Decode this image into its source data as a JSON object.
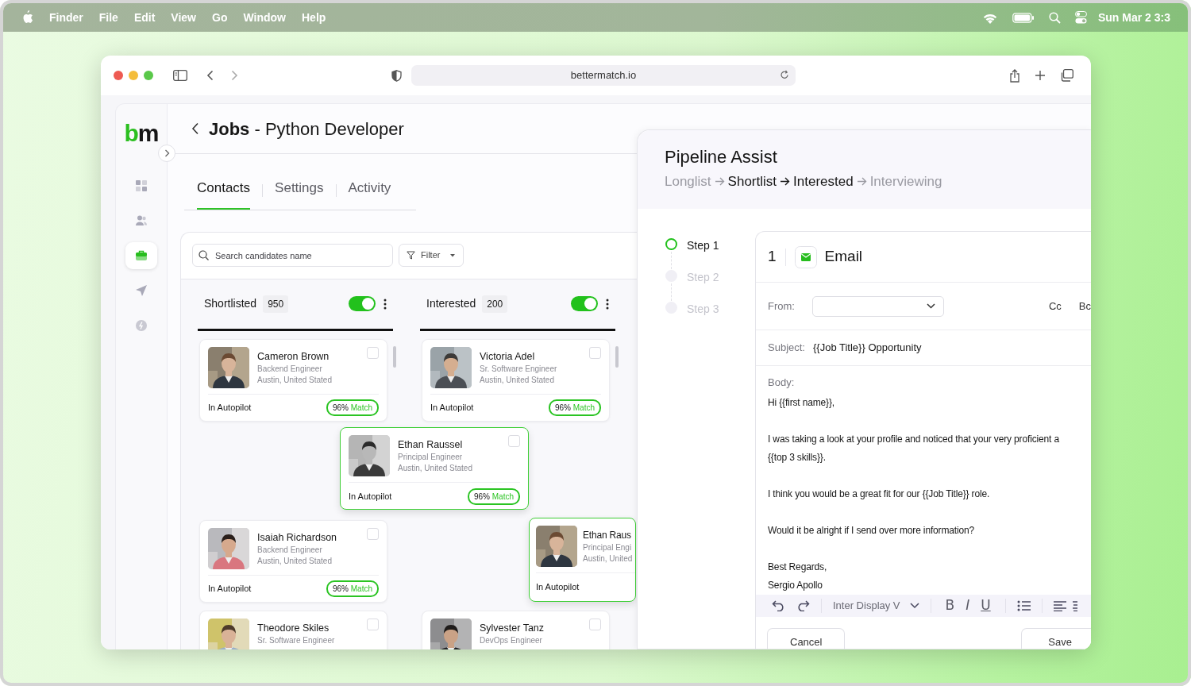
{
  "menubar": {
    "app": "Finder",
    "items": [
      "File",
      "Edit",
      "View",
      "Go",
      "Window",
      "Help"
    ],
    "clock": "Sun Mar 2 3:3"
  },
  "browser": {
    "address": "bettermatch.io"
  },
  "sidebar": {
    "logo": "bm",
    "items": [
      {
        "selected": false
      },
      {
        "selected": false
      },
      {
        "selected": true
      },
      {
        "selected": false
      },
      {
        "selected": false
      }
    ]
  },
  "page": {
    "title": "**Jobs** - Python Developer"
  },
  "tabs": [
    {
      "label": "Contacts",
      "selected": true
    },
    {
      "label": "Settings",
      "selected": false
    },
    {
      "label": "Activity",
      "selected": false
    }
  ],
  "search": {
    "placeholder": "Search candidates name"
  },
  "filter": {
    "label": "Filter"
  },
  "columns": [
    {
      "title": "Shortlisted",
      "count": "950",
      "on": true,
      "cards": [
        {
          "kind": "candidate",
          "name": "Cameron Brown",
          "role": "Backend Engineer",
          "location": "Austin, United Stated",
          "status": "In Autopilot",
          "match": "96%",
          "match_label": "Match",
          "checked": false
        },
        {
          "kind": "drop-slot"
        },
        {
          "kind": "candidate",
          "name": "Isaiah Richardson",
          "role": "Backend Engineer",
          "location": "Austin, United Stated",
          "status": "In Autopilot",
          "match": "96%",
          "match_label": "Match",
          "checked": false
        },
        {
          "kind": "candidate",
          "name": "Theodore Skiles",
          "role": "Sr. Software Engineer",
          "checked": false
        }
      ]
    },
    {
      "title": "Interested",
      "count": "200",
      "on": true,
      "cards": [
        {
          "kind": "candidate",
          "name": "Victoria Adel",
          "role": "Sr. Software Engineer",
          "location": "Austin, United Stated",
          "status": "In Autopilot",
          "match": "96%",
          "match_label": "Match",
          "checked": false
        },
        {
          "kind": "drop-slot"
        },
        {
          "kind": "drop-slot"
        },
        {
          "kind": "candidate",
          "name": "Sylvester Tanz",
          "role": "DevOps Engineer",
          "checked": false
        }
      ]
    }
  ],
  "dragged_cards": [
    {
      "name": "Ethan Raussel",
      "role": "Principal Engineer",
      "location": "Austin, United Stated",
      "status": "In Autopilot",
      "match": "96%",
      "match_label": "Match",
      "checked": false
    },
    {
      "name": "Ethan Raus",
      "role": "Principal Engi",
      "location": "Austin, United",
      "status": "In Autopilot"
    }
  ],
  "pipeline": {
    "title": "Pipeline Assist",
    "stages": [
      {
        "label": "Longlist",
        "active": false
      },
      {
        "label": "Shortlist",
        "active": true
      },
      {
        "label": "Interested",
        "active": true
      },
      {
        "label": "Interviewing",
        "active": false
      }
    ],
    "steps": [
      {
        "label": "Step 1",
        "selected": true
      },
      {
        "label": "Step 2",
        "selected": false
      },
      {
        "label": "Step 3",
        "selected": false
      }
    ],
    "email": {
      "number": "1",
      "type": "Email",
      "from_label": "From:",
      "cc": "Cc",
      "bcc": "Bc",
      "subject_label": "Subject:",
      "subject": "{{Job Title}} Opportunity",
      "body_label": "Body:",
      "paragraphs": [
        [
          "Hi {{first name}},"
        ],
        [
          "I was taking a look at your profile and noticed that your very proficient a",
          "{{top 3 skills}}."
        ],
        [
          "I think you would be a great fit for our {{Job Title}} role."
        ],
        [
          "Would it be alright if I send over more information?"
        ],
        [
          "Best Regards,",
          "Sergio Apollo"
        ]
      ],
      "font": "Inter Display V",
      "format": [
        {
          "label": "B",
          "kind": "bold"
        },
        {
          "label": "I",
          "kind": "italic"
        },
        {
          "label": "U",
          "kind": "underline"
        }
      ],
      "cancel": "Cancel",
      "save": "Save"
    }
  }
}
